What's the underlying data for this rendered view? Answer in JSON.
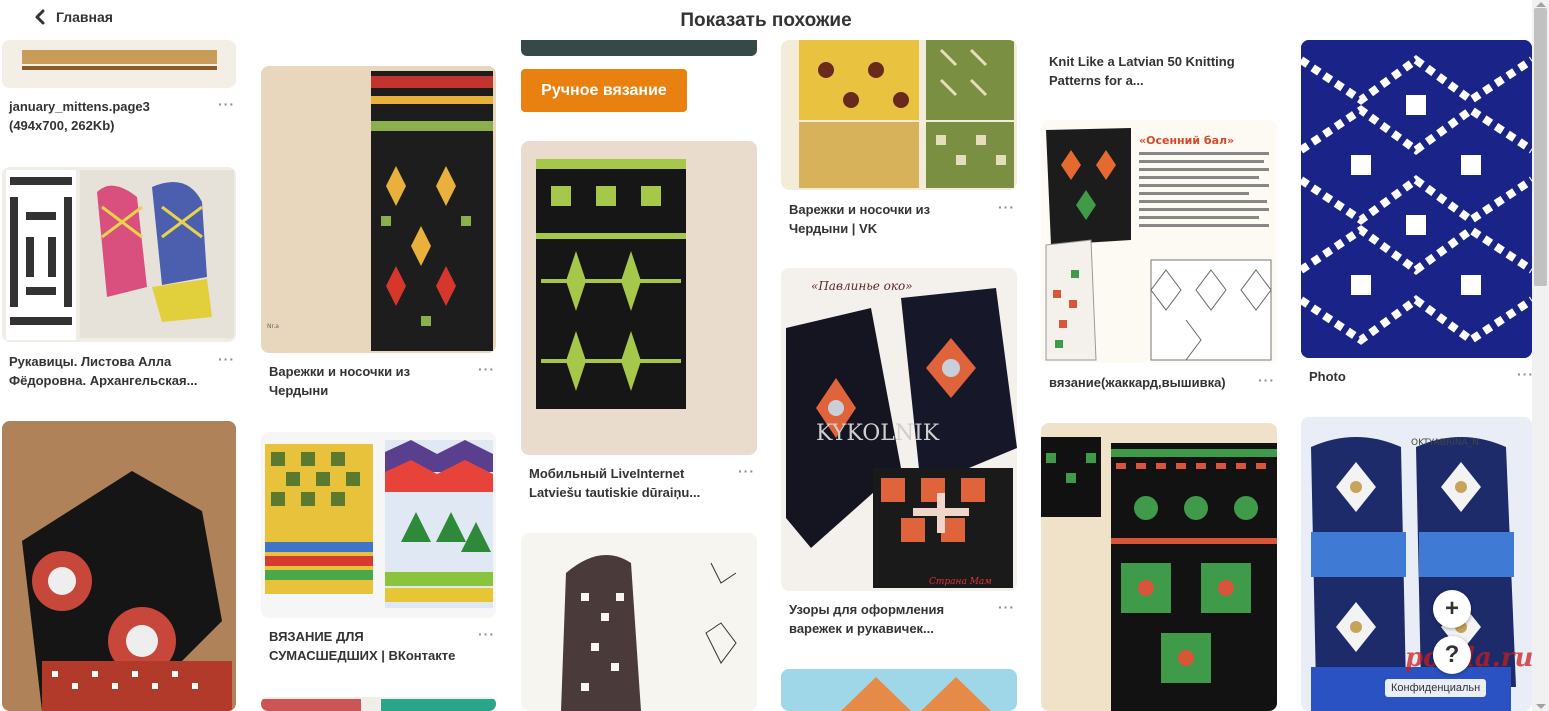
{
  "header": {
    "back_label": "Главная",
    "title": "Показать похожие"
  },
  "chip": {
    "label": "Ручное вязание"
  },
  "pins": [
    {
      "line1": "january_mittens.page3",
      "line2": "(494x700, 262Kb)"
    },
    {
      "line1": "Рукавицы. Листова Алла",
      "line2": "Фёдоровна. Архангельская..."
    },
    {
      "line1": "Варежки и носочки из",
      "line2": "Чердыни"
    },
    {
      "line1": "ВЯЗАНИЕ ДЛЯ",
      "line2": "СУМАСШЕДШИХ | ВКонтакте"
    },
    {
      "line1": "Мобильный LiveInternet",
      "line2": "Latviešu tautiskie dūraiņu..."
    },
    {
      "line1": "Варежки и носочки из",
      "line2": "Чердыни | VK"
    },
    {
      "line1": "Узоры для оформления",
      "line2": "варежек и рукавичек..."
    },
    {
      "line1": "Knit Like a Latvian 50 Knitting",
      "line2": "Patterns for a..."
    },
    {
      "line1": "вязание(жаккард,вышивка)",
      "line2": ""
    },
    {
      "line1": "Photo",
      "line2": ""
    }
  ],
  "image_texts": {
    "kykolnik": "KYKOLNIK",
    "pavlinie": "«Павлинье око»",
    "osenniy": "«Осенний бал»",
    "strana": "Страна Мам",
    "oktyabrina": "OKTYABRINA_N"
  },
  "more_label": "···",
  "fab": {
    "add": "+",
    "help": "?"
  },
  "privacy": "Конфиденциальн",
  "watermark": "posila.ru",
  "icons": {
    "back": "chevron-left-icon",
    "add": "plus-icon",
    "help": "question-icon",
    "more": "more-dots-icon"
  }
}
